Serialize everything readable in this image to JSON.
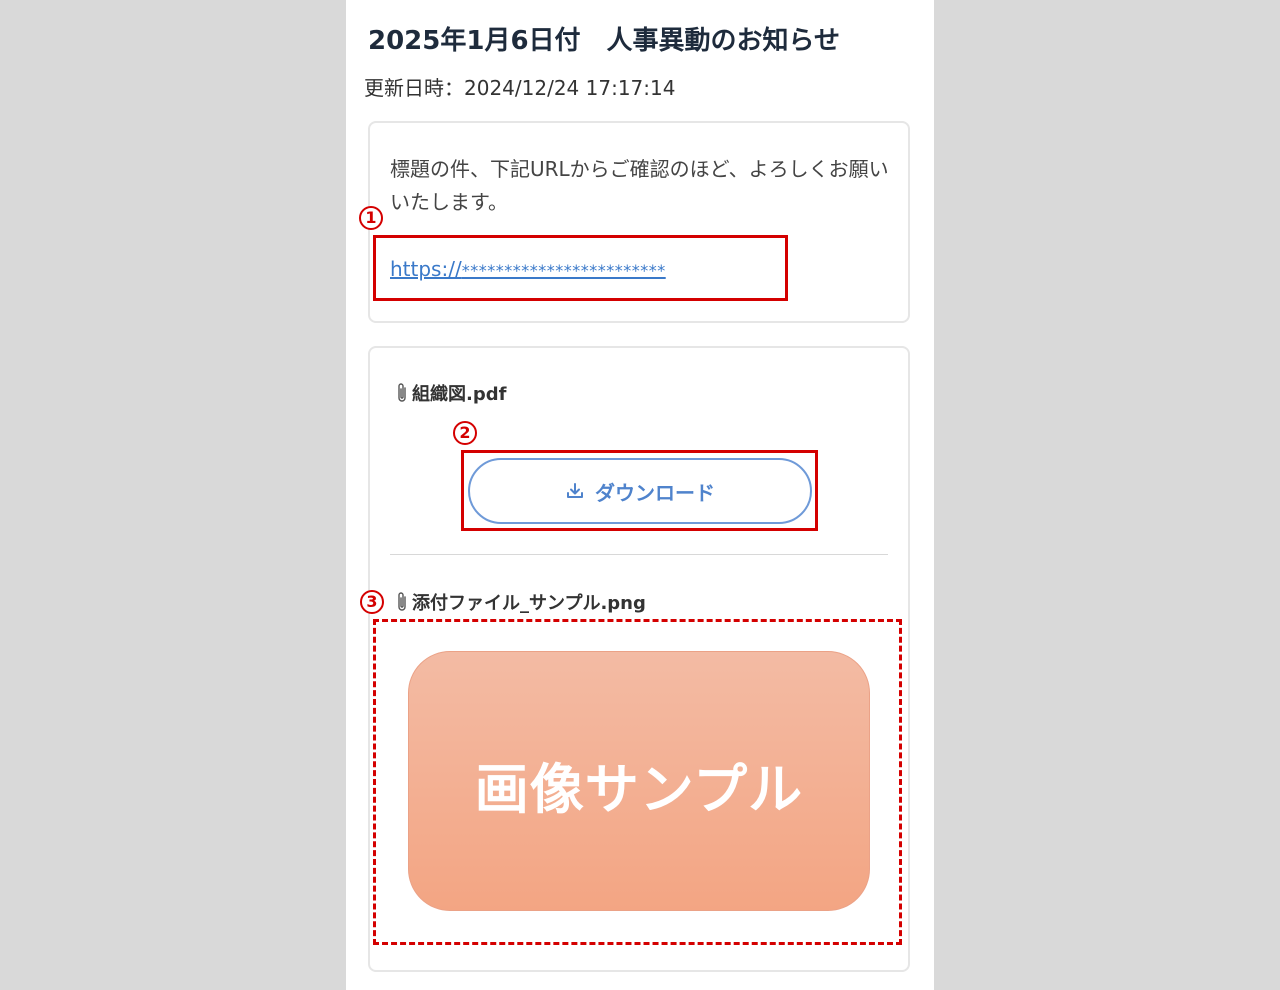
{
  "header": {
    "title": "2025年1月6日付　人事異動のお知らせ",
    "updated": "更新日時：2024/12/24 17:17:14"
  },
  "message": {
    "text": "標題の件、下記URLからご確認のほど、よろしくお願いいたします。",
    "link_prefix": "https://",
    "link_mask": "************************"
  },
  "attachments": {
    "file1": {
      "icon": "paperclip-icon",
      "name": "組織図.pdf",
      "download_label": "ダウンロード",
      "download_icon": "download-icon"
    },
    "file2": {
      "icon": "paperclip-icon",
      "name": "添付ファイル_サンプル.png",
      "image_text": "画像サンプル"
    }
  },
  "annotations": {
    "marker1": "1",
    "marker2": "2",
    "marker3": "3",
    "color": "#d40000"
  },
  "colors": {
    "link": "#3a79c9",
    "button_border": "#6f9ad8",
    "image_gradient_top": "#f3bba4",
    "image_gradient_bottom": "#f3a583"
  }
}
